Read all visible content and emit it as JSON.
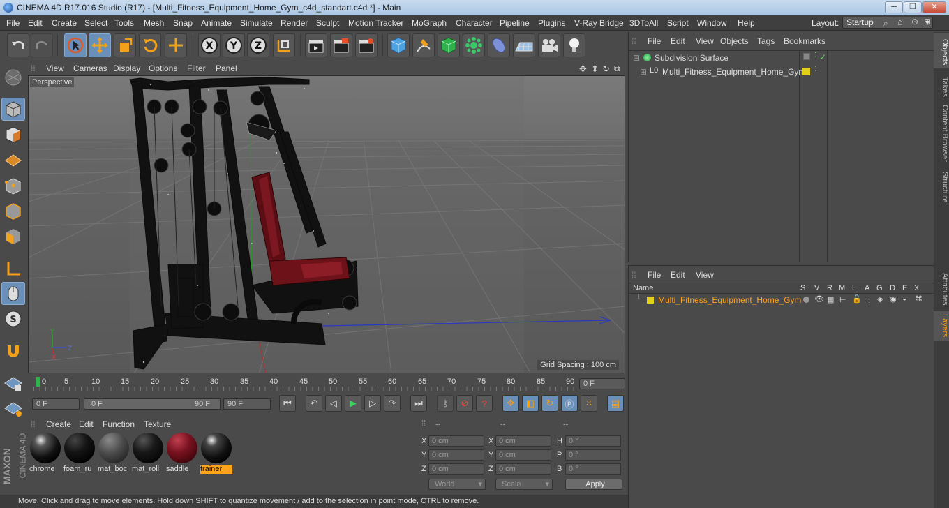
{
  "window": {
    "title": "CINEMA 4D R17.016 Studio (R17) - [Multi_Fitness_Equipment_Home_Gym_c4d_standart.c4d *] - Main"
  },
  "menu": [
    "File",
    "Edit",
    "Create",
    "Select",
    "Tools",
    "Mesh",
    "Snap",
    "Animate",
    "Simulate",
    "Render",
    "Sculpt",
    "Motion Tracker",
    "MoGraph",
    "Character",
    "Pipeline",
    "Plugins",
    "V-Ray Bridge",
    "3DToAll",
    "Script",
    "Window",
    "Help"
  ],
  "layout": {
    "label": "Layout:",
    "value": "Startup"
  },
  "viewport": {
    "menu": [
      "View",
      "Cameras",
      "Display",
      "Options",
      "Filter",
      "Panel"
    ],
    "camera_label": "Perspective",
    "grid_spacing": "Grid Spacing : 100 cm"
  },
  "timeline": {
    "ticks": [
      "0",
      "5",
      "10",
      "15",
      "20",
      "25",
      "30",
      "35",
      "40",
      "45",
      "50",
      "55",
      "60",
      "65",
      "70",
      "75",
      "80",
      "85",
      "90"
    ],
    "current_frame": "0 F",
    "start_field": "0 F",
    "range_start": "0 F",
    "range_end": "90 F",
    "end_field": "90 F"
  },
  "materials": {
    "menu": [
      "Create",
      "Edit",
      "Function",
      "Texture"
    ],
    "items": [
      {
        "name": "chrome"
      },
      {
        "name": "foam_ru"
      },
      {
        "name": "mat_boc"
      },
      {
        "name": "mat_roll"
      },
      {
        "name": "saddle"
      },
      {
        "name": "trainer"
      }
    ]
  },
  "coords": {
    "headers": [
      "--",
      "--",
      "--"
    ],
    "rows": [
      {
        "a": "X",
        "av": "0 cm",
        "b": "X",
        "bv": "0 cm",
        "c": "H",
        "cv": "0 °"
      },
      {
        "a": "Y",
        "av": "0 cm",
        "b": "Y",
        "bv": "0 cm",
        "c": "P",
        "cv": "0 °"
      },
      {
        "a": "Z",
        "av": "0 cm",
        "b": "Z",
        "bv": "0 cm",
        "c": "B",
        "cv": "0 °"
      }
    ],
    "world": "World",
    "scale": "Scale",
    "apply": "Apply"
  },
  "status": "Move: Click and drag to move elements. Hold down SHIFT to quantize movement / add to the selection in point mode, CTRL to remove.",
  "objects": {
    "menu": [
      "File",
      "Edit",
      "View",
      "Objects",
      "Tags",
      "Bookmarks"
    ],
    "items": [
      "Subdivision Surface",
      "Multi_Fitness_Equipment_Home_Gym"
    ]
  },
  "layers": {
    "menu": [
      "File",
      "Edit",
      "View"
    ],
    "columns": [
      "Name",
      "S",
      "V",
      "R",
      "M",
      "L",
      "A",
      "G",
      "D",
      "E",
      "X"
    ],
    "items": [
      "Multi_Fitness_Equipment_Home_Gym"
    ]
  },
  "side_tabs": [
    "Objects",
    "Takes",
    "Content Browser",
    "Structure",
    "Attributes",
    "Layers"
  ],
  "brand": [
    "MAXON",
    "CINEMA 4D"
  ],
  "colors": {
    "accent": "#ffa31a",
    "selection": "#6a8fb8",
    "layer_color": "#e3d018"
  }
}
